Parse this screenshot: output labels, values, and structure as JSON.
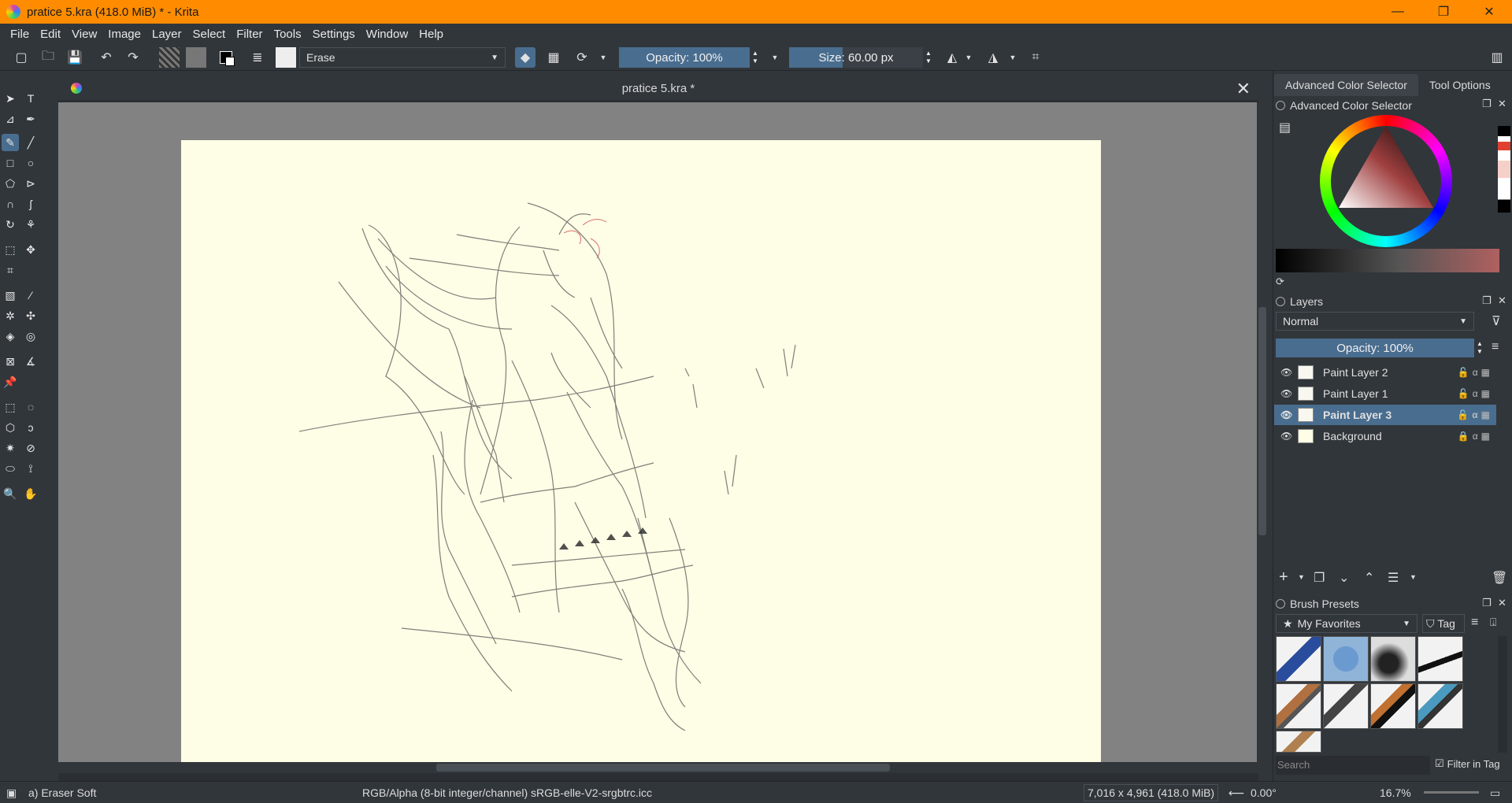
{
  "window": {
    "title": "pratice 5.kra (418.0 MiB)  * - Krita",
    "minimize": "—",
    "restore": "❐",
    "close": "✕"
  },
  "menu": [
    "File",
    "Edit",
    "View",
    "Image",
    "Layer",
    "Select",
    "Filter",
    "Tools",
    "Settings",
    "Window",
    "Help"
  ],
  "toolbar": {
    "blend_mode": "Erase",
    "opacity": "Opacity: 100%",
    "size_label": "Size:",
    "size_value": "60.00 px"
  },
  "document": {
    "tab_title": "pratice 5.kra *",
    "close": "✕"
  },
  "docker_tabs": [
    "Advanced Color Selector",
    "Tool Options"
  ],
  "color_selector": {
    "title": "Advanced Color Selector"
  },
  "layers": {
    "title": "Layers",
    "blend_mode": "Normal",
    "opacity": "Opacity:  100%",
    "items": [
      {
        "name": "Paint Layer 2",
        "selected": false,
        "locked": false
      },
      {
        "name": "Paint Layer 1",
        "selected": false,
        "locked": false
      },
      {
        "name": "Paint Layer 3",
        "selected": true,
        "locked": false
      },
      {
        "name": "Background",
        "selected": false,
        "locked": true
      }
    ]
  },
  "brush_presets": {
    "title": "Brush Presets",
    "tag_filter": "My Favorites",
    "tag_button": "Tag",
    "search_placeholder": "Search",
    "filter_in_tag": "Filter in Tag"
  },
  "status": {
    "brush": "a) Eraser Soft",
    "color_space": "RGB/Alpha (8-bit integer/channel)  sRGB-elle-V2-srgbtrc.icc",
    "dimensions": "7,016 x 4,961 (418.0 MiB)",
    "rotation": "0.00°",
    "zoom": "16.7%"
  },
  "colors": {
    "titlebar": "#ff8c00",
    "panel": "#31363b",
    "accent": "#496d8f",
    "canvas_bg": "#828282",
    "paper": "#fefde6"
  }
}
